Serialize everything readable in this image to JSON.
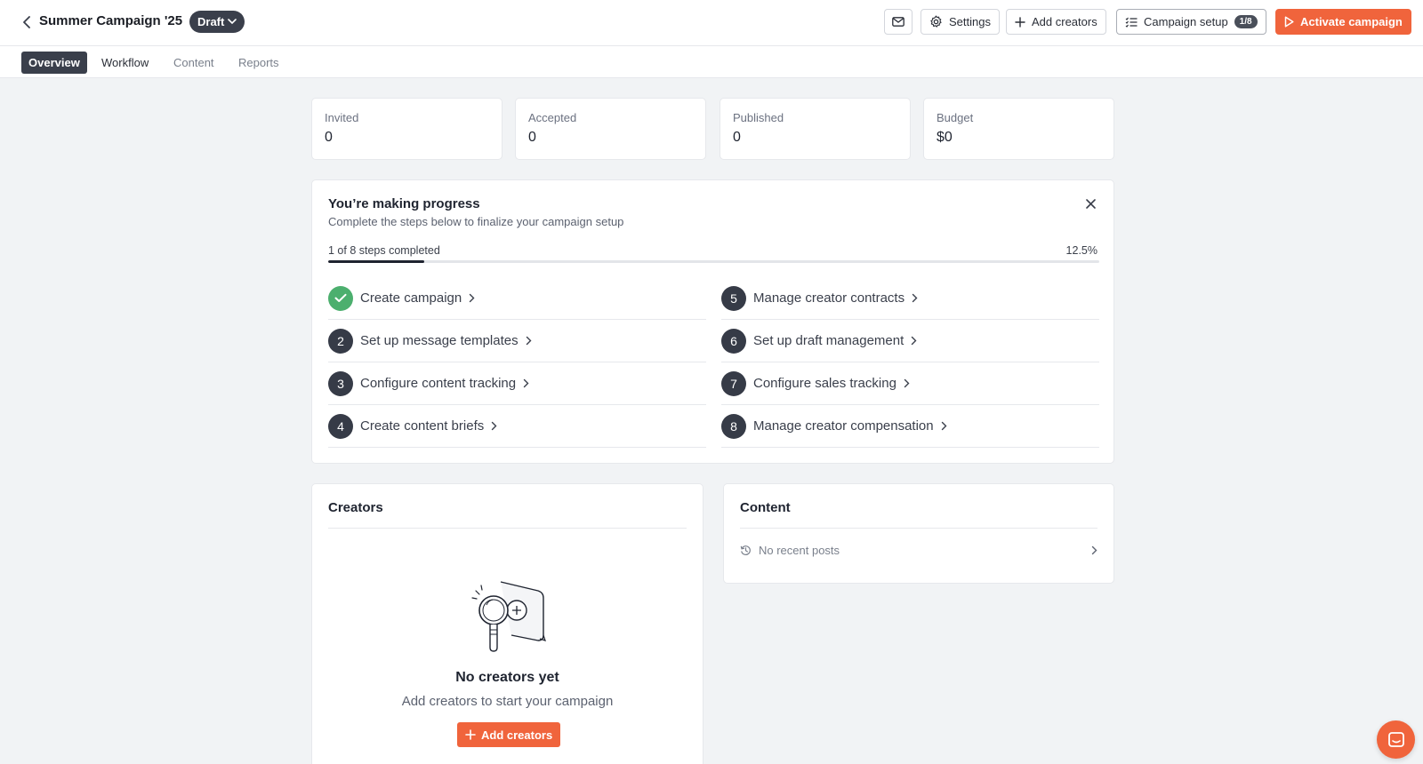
{
  "header": {
    "title": "Summer Campaign '25",
    "status": "Draft",
    "settings_label": "Settings",
    "add_creators_label": "Add creators",
    "campaign_setup_label": "Campaign setup",
    "campaign_setup_count": "1/8",
    "activate_label": "Activate campaign"
  },
  "tabs": [
    {
      "label": "Overview"
    },
    {
      "label": "Workflow"
    },
    {
      "label": "Content"
    },
    {
      "label": "Reports"
    }
  ],
  "stats": [
    {
      "label": "Invited",
      "value": "0"
    },
    {
      "label": "Accepted",
      "value": "0"
    },
    {
      "label": "Published",
      "value": "0"
    },
    {
      "label": "Budget",
      "value": "$0"
    }
  ],
  "progress": {
    "title": "You’re making progress",
    "subtitle": "Complete the steps below to finalize your campaign setup",
    "count_text": "1 of 8 steps completed",
    "percent_text": "12.5%",
    "percent_value": 12.5,
    "steps": [
      {
        "num": "1",
        "label": "Create campaign",
        "done": true
      },
      {
        "num": "2",
        "label": "Set up message templates",
        "done": false
      },
      {
        "num": "3",
        "label": "Configure content tracking",
        "done": false
      },
      {
        "num": "4",
        "label": "Create content briefs",
        "done": false
      },
      {
        "num": "5",
        "label": "Manage creator contracts",
        "done": false
      },
      {
        "num": "6",
        "label": "Set up draft management",
        "done": false
      },
      {
        "num": "7",
        "label": "Configure sales tracking",
        "done": false
      },
      {
        "num": "8",
        "label": "Manage creator compensation",
        "done": false
      }
    ]
  },
  "creators": {
    "title": "Creators",
    "empty_title": "No creators yet",
    "empty_subtitle": "Add creators to start your campaign",
    "button_label": "Add creators"
  },
  "content": {
    "title": "Content",
    "empty_text": "No recent posts"
  },
  "colors": {
    "accent": "#f0643c",
    "success": "#4caf6e",
    "dark": "#3a3f4b"
  }
}
